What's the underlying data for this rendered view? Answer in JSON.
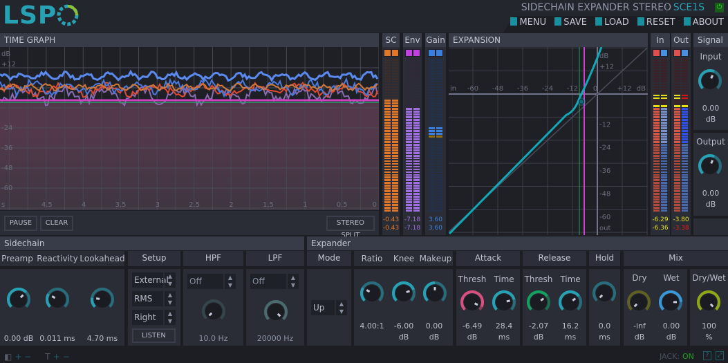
{
  "header": {
    "logo": "LSP",
    "plugin_title": "SIDECHAIN EXPANDER STEREO",
    "plugin_code": "SCE1S",
    "menu": [
      {
        "label": "MENU",
        "icon": "menu-icon"
      },
      {
        "label": "SAVE",
        "icon": "save-icon"
      },
      {
        "label": "LOAD",
        "icon": "load-icon"
      },
      {
        "label": "RESET",
        "icon": "reset-icon"
      },
      {
        "label": "ABOUT",
        "icon": "about-icon"
      }
    ]
  },
  "time_graph": {
    "title": "TIME GRAPH",
    "db_unit": "dB",
    "y_labels": [
      "+12",
      "-24",
      "-36",
      "-48",
      "-60"
    ],
    "x_labels": [
      "s",
      "4.5",
      "4",
      "3.5",
      "3",
      "2.5",
      "2",
      "1.5",
      "1",
      "0.5",
      "0"
    ],
    "pause": "PAUSE",
    "clear": "CLEAR",
    "stereo_split": "STEREO SPLIT"
  },
  "meters": {
    "sc": {
      "label": "SC",
      "values": [
        "-0.43",
        "-0.43"
      ],
      "level": 0.74,
      "color": "#e07828"
    },
    "env": {
      "label": "Env",
      "values": [
        "-7.18",
        "-7.18"
      ],
      "level": 0.67,
      "color": "#a060e0"
    },
    "gain": {
      "label": "Gain",
      "values": [
        "3.60",
        "3.60"
      ],
      "level": 0.53,
      "color": "#3a80e0"
    },
    "in": {
      "label": "In",
      "values": [
        "-6.29",
        "-6.36"
      ],
      "level": 0.7
    },
    "out": {
      "label": "Out",
      "values": [
        "-3.80",
        "-3.38"
      ],
      "level": 0.7
    }
  },
  "expansion": {
    "title": "EXPANSION",
    "in": "in",
    "out": "out",
    "db": "dB",
    "x_labels": [
      "-60",
      "-48",
      "-36",
      "-24",
      "-12",
      "0",
      "+12"
    ],
    "y_labels": [
      "+12",
      "-12",
      "-24",
      "-36",
      "-48",
      "-60"
    ]
  },
  "signal": {
    "title": "Signal",
    "input": {
      "label": "Input",
      "value": "0.00",
      "unit": "dB",
      "level": 0.59
    },
    "output": {
      "label": "Output",
      "value": "0.00",
      "unit": "dB",
      "level": 0.59
    }
  },
  "sidechain": {
    "title": "Sidechain",
    "preamp": {
      "label": "Preamp",
      "value": "0.00 dB",
      "level": 0.67
    },
    "reactivity": {
      "label": "Reactivity",
      "value": "0.011 ms",
      "level": 0.28
    },
    "lookahead": {
      "label": "Lookahead",
      "value": "4.70 ms",
      "level": 0.2
    },
    "setup": {
      "label": "Setup",
      "source": "External",
      "mode": "RMS",
      "channel": "Right",
      "listen": "LISTEN"
    },
    "hpf": {
      "label": "HPF",
      "mode": "Off",
      "value": "10.0 Hz",
      "level": 0.0
    },
    "lpf": {
      "label": "LPF",
      "mode": "Off",
      "value": "20000 Hz",
      "level": 1.0
    }
  },
  "expander": {
    "title": "Expander",
    "mode": {
      "label": "Mode",
      "value": "Up"
    },
    "ratio": {
      "label": "Ratio",
      "value": "4.00:1",
      "level": 0.28
    },
    "knee": {
      "label": "Knee",
      "value": "-6.00",
      "unit": "dB",
      "level": 0.76
    },
    "makeup": {
      "label": "Makeup",
      "value": "0.00",
      "unit": "dB",
      "level": 0.5
    },
    "attack": {
      "label": "Attack",
      "thresh": {
        "label": "Thresh",
        "value": "-6.49",
        "unit": "dB",
        "level": 0.93
      },
      "time": {
        "label": "Time",
        "value": "28.4",
        "unit": "ms",
        "level": 0.78
      }
    },
    "release": {
      "label": "Release",
      "thresh": {
        "label": "Thresh",
        "value": "-2.07",
        "unit": "dB",
        "level": 0.7
      },
      "time": {
        "label": "Time",
        "value": "16.2",
        "unit": "ms",
        "level": 0.7
      }
    },
    "hold": {
      "label": "Hold",
      "value": "0.0",
      "unit": "ms",
      "level": 0.0
    },
    "mix": {
      "label": "Mix",
      "dry": {
        "label": "Dry",
        "value": "-inf",
        "unit": "dB",
        "level": 0.0
      },
      "wet": {
        "label": "Wet",
        "value": "0.00",
        "unit": "dB",
        "level": 0.83
      },
      "drywet": {
        "label": "Dry/Wet",
        "value": "100",
        "unit": "%",
        "level": 1.0
      }
    }
  },
  "footer": {
    "jack_label": "JACK:",
    "jack_state": "ON"
  },
  "colors": {
    "accent": "#27a2b4",
    "attack_thresh": "#d8507e",
    "release_thresh": "#14a060",
    "dry": "#8a8a10",
    "wet": "#3898d8",
    "drywet": "#90a818",
    "on": "#20c020"
  }
}
